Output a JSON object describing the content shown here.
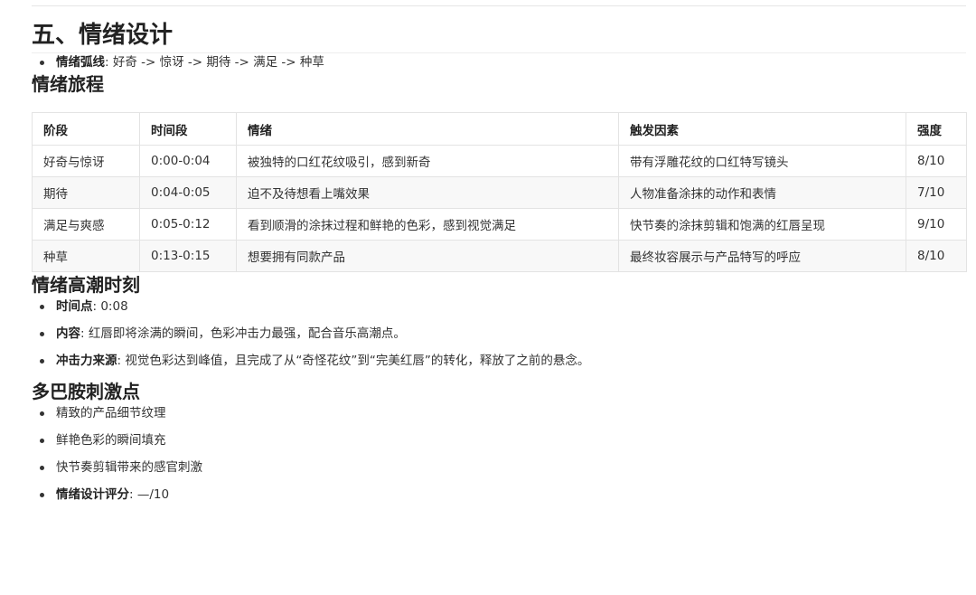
{
  "section": {
    "title": "五、情绪设计"
  },
  "arc": {
    "label": "情绪弧线",
    "text": ": 好奇 -> 惊讶 -> 期待 -> 满足 -> 种草"
  },
  "journey": {
    "title": "情绪旅程",
    "headers": [
      "阶段",
      "时间段",
      "情绪",
      "触发因素",
      "强度"
    ],
    "rows": [
      [
        "好奇与惊讶",
        "0:00-0:04",
        "被独特的口红花纹吸引，感到新奇",
        "带有浮雕花纹的口红特写镜头",
        "8/10"
      ],
      [
        "期待",
        "0:04-0:05",
        "迫不及待想看上嘴效果",
        "人物准备涂抹的动作和表情",
        "7/10"
      ],
      [
        "满足与爽感",
        "0:05-0:12",
        "看到顺滑的涂抹过程和鲜艳的色彩，感到视觉满足",
        "快节奏的涂抹剪辑和饱满的红唇呈现",
        "9/10"
      ],
      [
        "种草",
        "0:13-0:15",
        "想要拥有同款产品",
        "最终妆容展示与产品特写的呼应",
        "8/10"
      ]
    ]
  },
  "peak": {
    "title": "情绪高潮时刻",
    "items": [
      {
        "label": "时间点",
        "text": ": 0:08"
      },
      {
        "label": "内容",
        "text": ": 红唇即将涂满的瞬间，色彩冲击力最强，配合音乐高潮点。"
      },
      {
        "label": "冲击力来源",
        "text": ": 视觉色彩达到峰值，且完成了从“奇怪花纹”到“完美红唇”的转化，释放了之前的悬念。"
      }
    ]
  },
  "dopamine": {
    "title": "多巴胺刺激点",
    "items": [
      "精致的产品细节纹理",
      "鲜艳色彩的瞬间填充",
      "快节奏剪辑带来的感官刺激"
    ],
    "score_label": "情绪设计评分",
    "score_text": ": —/10"
  }
}
